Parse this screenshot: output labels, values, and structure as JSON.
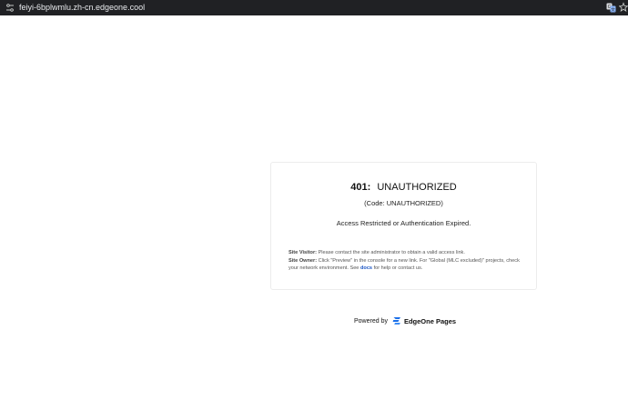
{
  "browser": {
    "url": "feiyi-6bplwmlu.zh-cn.edgeone.cool",
    "icons": [
      "site-info-icon",
      "translate-icon",
      "bookmark-star-icon"
    ]
  },
  "error": {
    "status_code": "401:",
    "status_text": "UNAUTHORIZED",
    "code_line": "(Code: UNAUTHORIZED)",
    "message": "Access Restricted or Authentication Expired.",
    "visitor_label": "Site Visitor:",
    "visitor_text": " Please contact the site administrator to obtain a valid access link.",
    "owner_label": "Site Owner:",
    "owner_text": " Click \"Preview\" in the console for a new link. For \"Global (MLC excluded)\" projects, check your network environment. See ",
    "docs_link": "docs",
    "owner_text_end": " for help or contact us."
  },
  "footer": {
    "powered_by": "Powered by",
    "brand": "EdgeOne Pages",
    "brand_color": "#1a6ee8"
  }
}
